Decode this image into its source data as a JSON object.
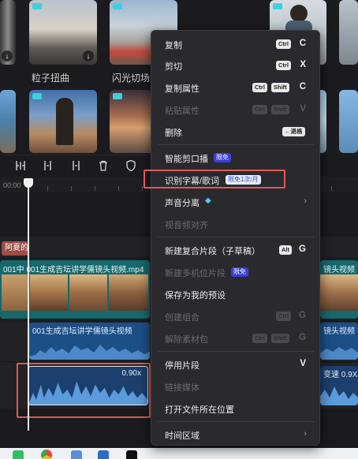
{
  "media": {
    "labels": {
      "particle": "粒子扭曲",
      "flash": "闪光切场"
    }
  },
  "timeline": {
    "ruler_time": "00:00",
    "pink_clip_label": "阿夏的",
    "video_clip_title": "001中 001生成吉坛讲学儒镜头视频.mp4",
    "video_clip_right_title": "镜头视频",
    "audio_clip_title": "001生成吉坛讲学儒镜头视频",
    "audio_clip_right_title": "镜头视频",
    "selected_audio_speed": "0.90x",
    "right_audio_speed": "变速 0.9X"
  },
  "menu": {
    "copy": {
      "label": "复制",
      "key": "Ctrl",
      "letter": "C"
    },
    "cut": {
      "label": "剪切",
      "key": "Ctrl",
      "letter": "X"
    },
    "copy_attr": {
      "label": "复制属性",
      "key1": "Ctrl",
      "key2": "Shift",
      "letter": "C"
    },
    "paste_attr": {
      "label": "粘贴属性",
      "key1": "Ctrl",
      "key2": "Shift",
      "letter": "V"
    },
    "delete": {
      "label": "删除",
      "key": "←退格"
    },
    "smart_cut": {
      "label": "智能剪口播",
      "badge": "限免"
    },
    "recognize": {
      "label": "识别字幕/歌词",
      "badge": "限免1次/月"
    },
    "audio_separate": {
      "label": "声音分离"
    },
    "audio_align": {
      "label": "视音频对齐"
    },
    "new_compound": {
      "label": "新建复合片段（子草稿）",
      "key": "Alt",
      "letter": "G"
    },
    "new_multicam": {
      "label": "新建多机位片段",
      "badge": "限免"
    },
    "save_preset": {
      "label": "保存为我的预设"
    },
    "create_group": {
      "label": "创建组合",
      "key": "Ctrl",
      "letter": "G"
    },
    "ungroup": {
      "label": "解除素材包",
      "key1": "Ctrl",
      "key2": "Shift",
      "letter": "G"
    },
    "disable_clip": {
      "label": "停用片段",
      "letter": "V"
    },
    "link_media": {
      "label": "链接媒体"
    },
    "open_location": {
      "label": "打开文件所在位置"
    },
    "time_range": {
      "label": "时间区域"
    }
  },
  "icons": [
    "split-icon",
    "split-left-icon",
    "split-right-icon",
    "delete-icon",
    "shield-icon",
    "diamond-icon",
    "chevron-right-icon"
  ],
  "colors": {
    "accent_red": "#e05a56",
    "video_clip": "#17686d",
    "audio_clip": "#1d4f87",
    "badge_blue": "#3a3ed6"
  }
}
